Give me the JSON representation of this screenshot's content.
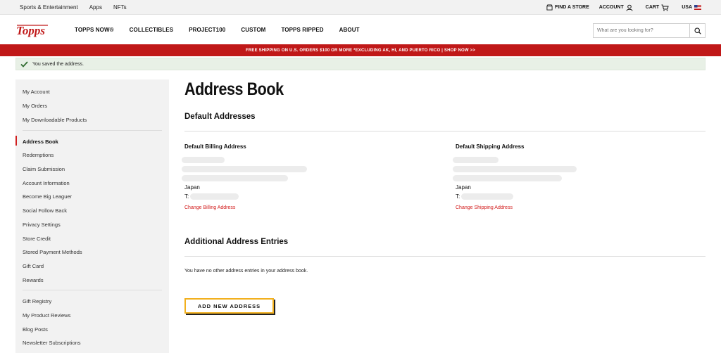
{
  "utility_bar": {
    "links": [
      "Sports & Entertainment",
      "Apps",
      "NFTs"
    ],
    "find_store": "FIND A STORE",
    "account": "ACCOUNT",
    "cart": "CART",
    "region": "USA"
  },
  "header": {
    "logo_text": "Topps",
    "nav": [
      "TOPPS NOW®",
      "COLLECTIBLES",
      "PROJECT100",
      "CUSTOM",
      "TOPPS RIPPED",
      "ABOUT"
    ],
    "search_placeholder": "What are you looking for?"
  },
  "promo_banner": "FREE SHIPPING ON U.S. ORDERS $100 OR MORE *EXCLUDING AK, HI, AND PUERTO RICO | SHOP NOW >>",
  "success_message": "You saved the address.",
  "sidebar": {
    "group1": [
      "My Account",
      "My Orders",
      "My Downloadable Products"
    ],
    "group2": [
      "Address Book",
      "Redemptions",
      "Claim Submission",
      "Account Information",
      "Become Big Leaguer",
      "Social Follow Back",
      "Privacy Settings",
      "Store Credit",
      "Stored Payment Methods",
      "Gift Card",
      "Rewards"
    ],
    "group3": [
      "Gift Registry",
      "My Product Reviews",
      "Blog Posts",
      "Newsletter Subscriptions"
    ],
    "active": "Address Book"
  },
  "main": {
    "title": "Address Book",
    "default_section_title": "Default Addresses",
    "billing": {
      "title": "Default Billing Address",
      "country": "Japan",
      "phone_label": "T:",
      "change_link": "Change Billing Address"
    },
    "shipping": {
      "title": "Default Shipping Address",
      "country": "Japan",
      "phone_label": "T:",
      "change_link": "Change Shipping Address"
    },
    "additional_section_title": "Additional Address Entries",
    "empty_message": "You have no other address entries in your address book.",
    "add_button": "ADD NEW ADDRESS"
  },
  "colors": {
    "brand_red": "#c01818",
    "link_red": "#d21a1a",
    "button_border": "#f2b01e",
    "success_bg": "#e8f0e6",
    "success_check": "#2e6b2e"
  }
}
